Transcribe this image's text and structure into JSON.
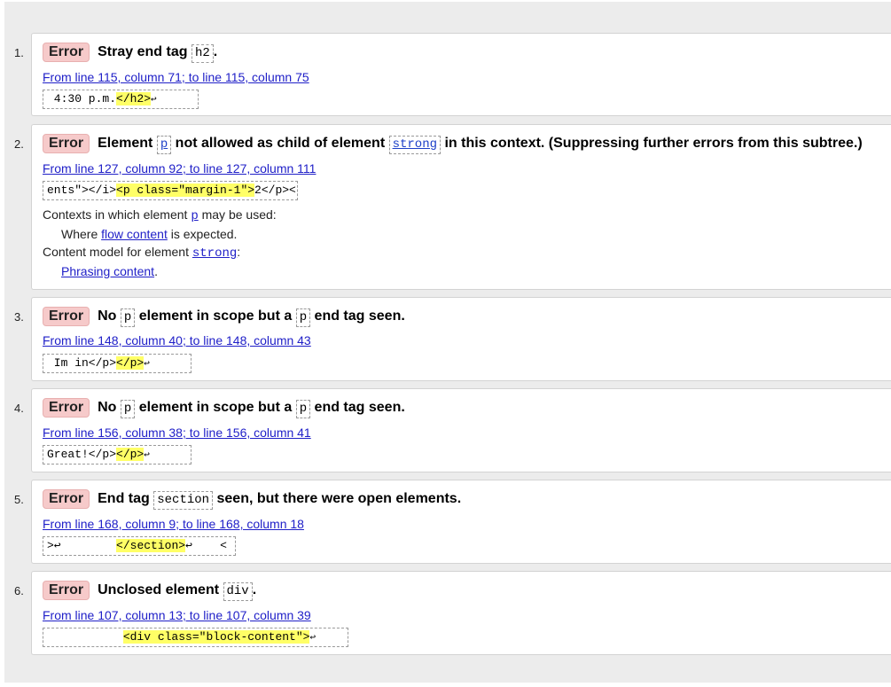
{
  "messages": [
    {
      "number": "1.",
      "badge": "Error",
      "title_parts": [
        "Stray end tag ",
        "h2",
        "."
      ],
      "location": "From line 115, column 71; to line 115, column 75",
      "extract_pre": " 4:30 p.m.",
      "extract_hl": "</h2>",
      "extract_post": "↩"
    },
    {
      "number": "2.",
      "badge": "Error",
      "title_parts": [
        "Element ",
        "p",
        " not allowed as child of element ",
        "strong",
        " in this context. (Suppressing further errors from this subtree.)"
      ],
      "location": "From line 127, column 92; to line 127, column 111",
      "extract_pre": "ents\"></i>",
      "extract_hl": "<p class=\"margin-1\">",
      "extract_post": "2</p><",
      "contexts_label": "Contexts in which element ",
      "contexts_code": "p",
      "contexts_suffix": " may be used:",
      "where_prefix": "Where ",
      "where_link": "flow content",
      "where_suffix": " is expected.",
      "model_label": "Content model for element ",
      "model_code": "strong",
      "model_suffix": ":",
      "phrasing_link": "Phrasing content",
      "phrasing_suffix": "."
    },
    {
      "number": "3.",
      "badge": "Error",
      "title_parts": [
        "No ",
        "p",
        " element in scope but a ",
        "p",
        " end tag seen."
      ],
      "location": "From line 148, column 40; to line 148, column 43",
      "extract_pre": " Im in</p>",
      "extract_hl": "</p>",
      "extract_post": "↩"
    },
    {
      "number": "4.",
      "badge": "Error",
      "title_parts": [
        "No ",
        "p",
        " element in scope but a ",
        "p",
        " end tag seen."
      ],
      "location": "From line 156, column 38; to line 156, column 41",
      "extract_pre": "Great!</p>",
      "extract_hl": "</p>",
      "extract_post": "↩"
    },
    {
      "number": "5.",
      "badge": "Error",
      "title_parts": [
        "End tag ",
        "section",
        " seen, but there were open elements."
      ],
      "location": "From line 168, column 9; to line 168, column 18",
      "extract_pre": ">↩        ",
      "extract_hl": "</section>",
      "extract_post": "↩    <"
    },
    {
      "number": "6.",
      "badge": "Error",
      "title_parts": [
        "Unclosed element ",
        "div",
        "."
      ],
      "location": "From line 107, column 13; to line 107, column 39",
      "extract_pre": "           ",
      "extract_hl": "<div class=\"block-content\">",
      "extract_post": "↩"
    }
  ]
}
